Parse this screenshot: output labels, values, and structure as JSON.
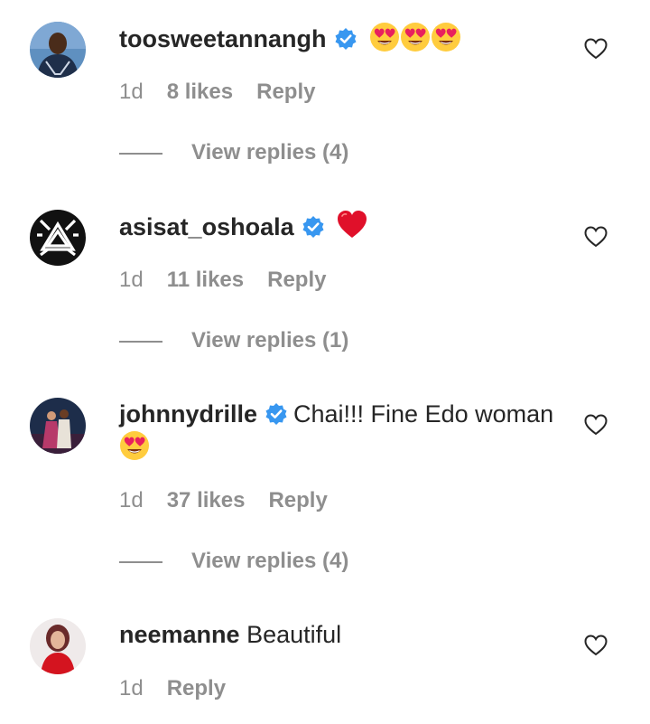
{
  "colors": {
    "text": "#262626",
    "secondary": "#8e8e8e",
    "verified": "#3897f0"
  },
  "comments": [
    {
      "username": "toosweetannangh",
      "verified": true,
      "text": "",
      "emojis": [
        "heart-eyes",
        "heart-eyes",
        "heart-eyes"
      ],
      "time": "1d",
      "likes": "8 likes",
      "reply": "Reply",
      "view_replies": "View replies (4)"
    },
    {
      "username": "asisat_oshoala",
      "verified": true,
      "text": "",
      "emojis": [
        "red-heart"
      ],
      "time": "1d",
      "likes": "11 likes",
      "reply": "Reply",
      "view_replies": "View replies (1)"
    },
    {
      "username": "johnnydrille",
      "verified": true,
      "text": "Chai!!! Fine Edo woman",
      "emojis": [
        "heart-eyes"
      ],
      "time": "1d",
      "likes": "37 likes",
      "reply": "Reply",
      "view_replies": "View replies (4)"
    },
    {
      "username": "neemanne",
      "verified": false,
      "text": "Beautiful",
      "emojis": [],
      "time": "1d",
      "likes": "",
      "reply": "Reply",
      "view_replies": ""
    }
  ]
}
